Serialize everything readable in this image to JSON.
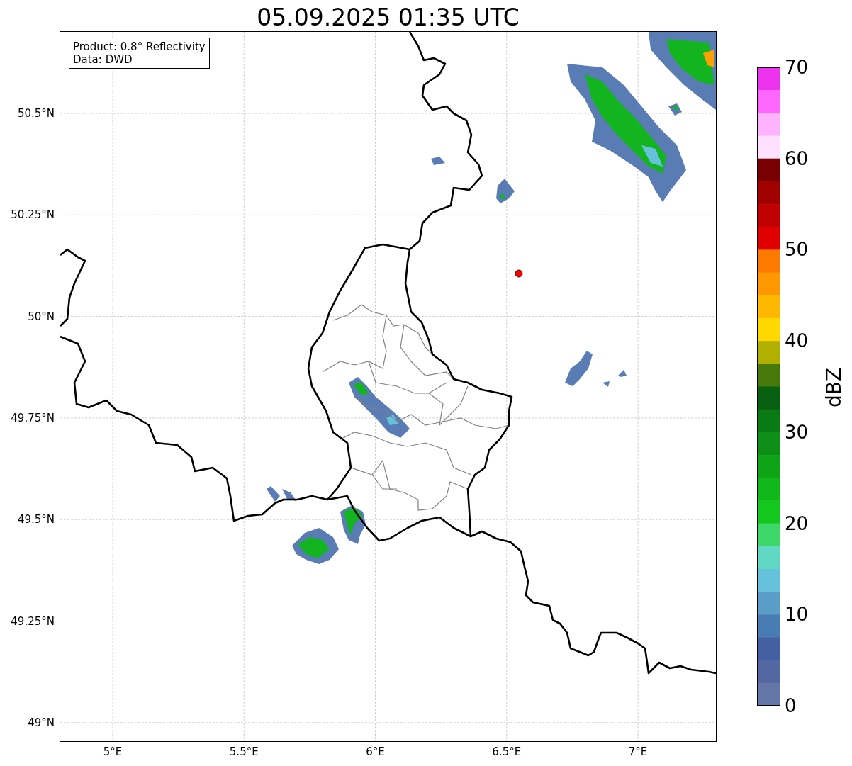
{
  "title": "05.09.2025 01:35 UTC",
  "info_box": [
    "Product: 0.8° Reflectivity",
    "Data: DWD"
  ],
  "y_ticks": [
    "50.5°N",
    "50.25°N",
    "50°N",
    "49.75°N",
    "49.5°N",
    "49.25°N",
    "49°N"
  ],
  "x_ticks": [
    "5°E",
    "5.5°E",
    "6°E",
    "6.5°E",
    "7°E"
  ],
  "colorbar": {
    "label": "dBZ",
    "ticks": [
      "70",
      "60",
      "50",
      "40",
      "30",
      "20",
      "10",
      "0"
    ],
    "bands": [
      {
        "color": "#ee33ee"
      },
      {
        "color": "#ff66ff"
      },
      {
        "color": "#ffb3ff"
      },
      {
        "color": "#ffe0ff"
      },
      {
        "color": "#780000"
      },
      {
        "color": "#a00000"
      },
      {
        "color": "#c00000"
      },
      {
        "color": "#e00000"
      },
      {
        "color": "#ff7a00"
      },
      {
        "color": "#ff9800"
      },
      {
        "color": "#ffb800"
      },
      {
        "color": "#ffd800"
      },
      {
        "color": "#b0b000"
      },
      {
        "color": "#46780a"
      },
      {
        "color": "#066010"
      },
      {
        "color": "#0a7a12"
      },
      {
        "color": "#0d8e16"
      },
      {
        "color": "#0fa418"
      },
      {
        "color": "#10b81a"
      },
      {
        "color": "#12c81c"
      },
      {
        "color": "#3ed86a"
      },
      {
        "color": "#60d8c4"
      },
      {
        "color": "#66c2dc"
      },
      {
        "color": "#5a9ec8"
      },
      {
        "color": "#4a7cb4"
      },
      {
        "color": "#4460a3"
      },
      {
        "color": "#5367a0"
      },
      {
        "color": "#6577a8"
      }
    ]
  }
}
